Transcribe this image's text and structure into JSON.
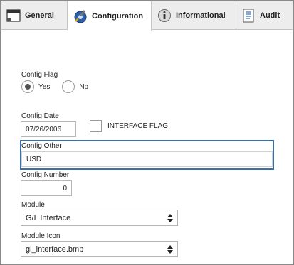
{
  "tabs": [
    {
      "label": "General",
      "icon": "window-icon"
    },
    {
      "label": "Configuration",
      "icon": "configuration-icon"
    },
    {
      "label": "Informational",
      "icon": "info-icon"
    },
    {
      "label": "Audit",
      "icon": "document-icon"
    }
  ],
  "active_tab": "Configuration",
  "form": {
    "config_flag": {
      "label": "Config Flag",
      "options": [
        "Yes",
        "No"
      ],
      "selected": "Yes"
    },
    "config_date": {
      "label": "Config Date",
      "value": "07/26/2006"
    },
    "interface_flag": {
      "label": "INTERFACE FLAG",
      "checked": false
    },
    "config_other": {
      "label": "Config Other",
      "value": "USD"
    },
    "config_number": {
      "label": "Config Number",
      "value": "0"
    },
    "module": {
      "label": "Module",
      "value": "G/L Interface"
    },
    "module_icon": {
      "label": "Module Icon",
      "value": "gl_interface.bmp"
    }
  },
  "colors": {
    "focus_border": "#3b6fa8",
    "tab_bar": "#ededed"
  }
}
